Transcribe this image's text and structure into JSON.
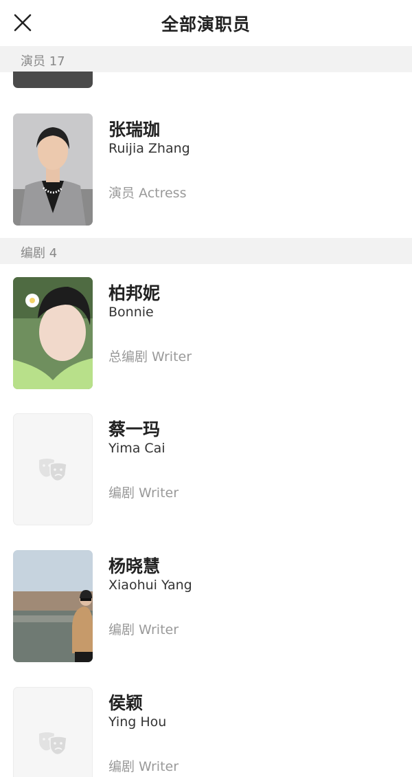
{
  "header": {
    "title": "全部演职员"
  },
  "sections": [
    {
      "label": "演员 17"
    },
    {
      "label": "编剧 4"
    }
  ],
  "people": [
    {
      "name_cn": "张瑞珈",
      "name_en": "Ruijia Zhang",
      "role": "演员 Actress"
    },
    {
      "name_cn": "柏邦妮",
      "name_en": "Bonnie",
      "role": "总编剧 Writer"
    },
    {
      "name_cn": "蔡一玛",
      "name_en": "Yima Cai",
      "role": "编剧 Writer"
    },
    {
      "name_cn": "杨晓慧",
      "name_en": "Xiaohui Yang",
      "role": "编剧 Writer"
    },
    {
      "name_cn": "侯颖",
      "name_en": "Ying Hou",
      "role": "编剧 Writer"
    }
  ],
  "icons": {
    "close": "close-icon",
    "placeholder": "theater-masks-icon"
  }
}
